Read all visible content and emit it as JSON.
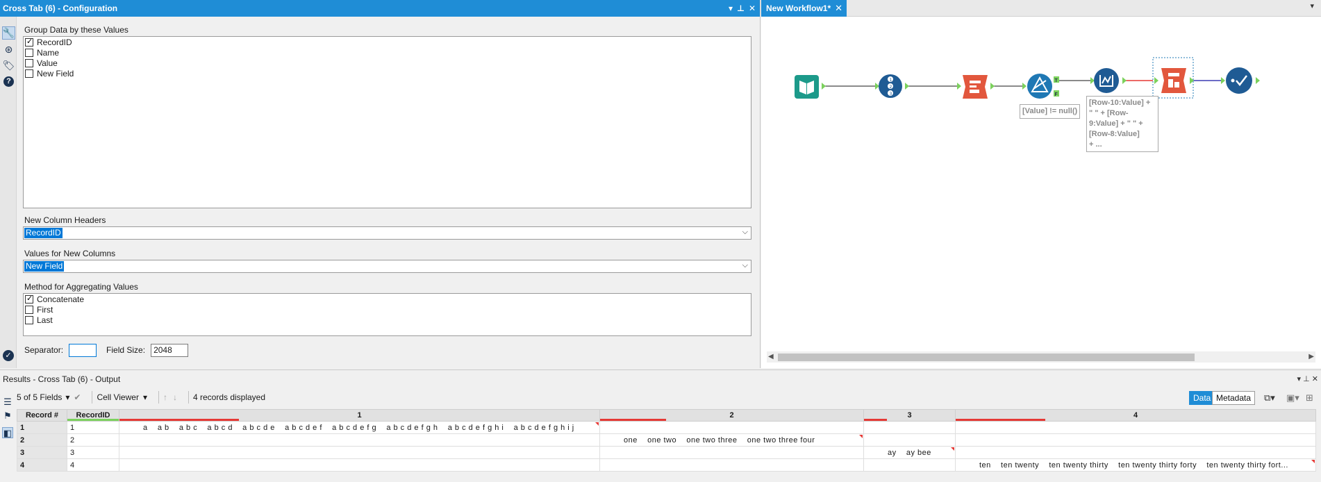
{
  "config": {
    "title": "Cross Tab (6) - Configuration",
    "group_label": "Group Data by these Values",
    "group_fields": [
      {
        "label": "RecordID",
        "checked": true
      },
      {
        "label": "Name",
        "checked": false
      },
      {
        "label": "Value",
        "checked": false
      },
      {
        "label": "New Field",
        "checked": false
      }
    ],
    "headers_label": "New Column Headers",
    "headers_value": "RecordID",
    "values_label": "Values for New Columns",
    "values_value": "New Field",
    "method_label": "Method for Aggregating Values",
    "methods": [
      {
        "label": "Concatenate",
        "checked": true
      },
      {
        "label": "First",
        "checked": false
      },
      {
        "label": "Last",
        "checked": false
      }
    ],
    "separator_label": "Separator:",
    "separator_value": "",
    "field_size_label": "Field Size:",
    "field_size_value": "2048"
  },
  "workflow": {
    "tab_label": "New Workflow1*",
    "filter_annotation": "[Value] != null()",
    "formula_annotation": [
      "[Row-10:Value] +",
      "\" \" + [Row-",
      "9:Value] + \" \" +",
      "[Row-8:Value]",
      "+ ..."
    ],
    "anchor_true": "T",
    "anchor_false": "F"
  },
  "results": {
    "title": "Results - Cross Tab (6) - Output",
    "fields_selector": "5 of 5 Fields",
    "viewer": "Cell Viewer",
    "record_count": "4 records displayed",
    "data_tab": "Data",
    "metadata_tab": "Metadata",
    "columns": [
      "Record #",
      "RecordID",
      "1",
      "2",
      "3",
      "4"
    ],
    "rows": [
      {
        "num": "1",
        "id": "1",
        "c1": "a    a b    a b c    a b c d    a b c d e    a b c d e f    a b c d e f g    a b c d e f g h    a b c d e f g h i    a b c d e f g h i j",
        "c2": "",
        "c3": "",
        "c4": ""
      },
      {
        "num": "2",
        "id": "2",
        "c1": "",
        "c2": "one    one two    one two three    one two three four",
        "c3": "",
        "c4": ""
      },
      {
        "num": "3",
        "id": "3",
        "c1": "",
        "c2": "",
        "c3": "ay    ay bee",
        "c4": ""
      },
      {
        "num": "4",
        "id": "4",
        "c1": "",
        "c2": "",
        "c3": "",
        "c4": "ten    ten twenty    ten twenty thirty    ten twenty thirty forty    ten twenty thirty fort..."
      }
    ]
  },
  "colors": {
    "accent": "#1f8dd6",
    "input_tool": "#1c9a8a",
    "tool_navy": "#1f5b94",
    "transform_red": "#e2573d",
    "filter_blue": "#1f78b4"
  }
}
